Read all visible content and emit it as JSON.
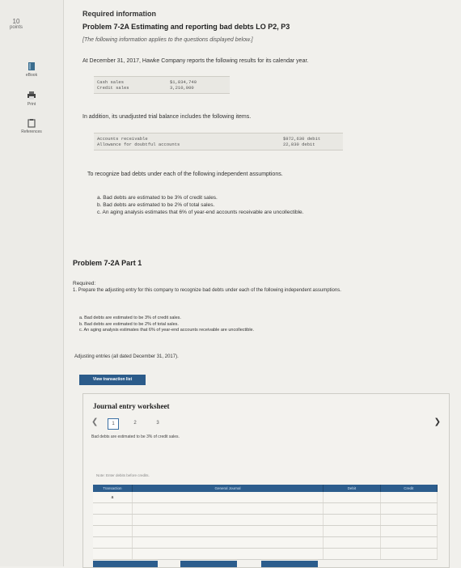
{
  "sidebar": {
    "points_value": "10",
    "points_label": "points",
    "tools": [
      {
        "label": "eBook",
        "icon": "book-icon"
      },
      {
        "label": "Print",
        "icon": "print-icon"
      },
      {
        "label": "References",
        "icon": "references-icon"
      }
    ]
  },
  "header": {
    "required_info": "Required information",
    "problem_title": "Problem 7-2A Estimating and reporting bad debts LO P2, P3",
    "info_note": "[The following information applies to the questions displayed below.]",
    "intro": "At December 31, 2017, Hawke Company reports the following results for its calendar year."
  },
  "sales_table": [
    {
      "label": "Cash sales",
      "value": "$1,834,740"
    },
    {
      "label": "Credit sales",
      "value": "3,210,000"
    }
  ],
  "balance_intro": "In addition, its unadjusted trial balance includes the following items.",
  "balance_table": [
    {
      "label": "Accounts receivable",
      "value": "$972,630 debit"
    },
    {
      "label": "Allowance for doubtful accounts",
      "value": "22,830 debit"
    }
  ],
  "recognize_intro": "To recognize bad debts under each of the following independent assumptions.",
  "assumptions": [
    "a. Bad debts are estimated to be 3% of credit sales.",
    "b. Bad debts are estimated to be 2% of total sales.",
    "c. An aging analysis estimates that 6% of year-end accounts receivable are uncollectible."
  ],
  "part": {
    "title": "Problem 7-2A Part 1",
    "required_label": "Required:",
    "required_text": "1. Prepare the adjusting entry for this company to recognize bad debts under each of the following independent assumptions.",
    "adjusting_label": "Adjusting entries (all dated December 31, 2017)."
  },
  "view_button": "View transaction list",
  "worksheet": {
    "title": "Journal entry worksheet",
    "pages": [
      "1",
      "2",
      "3"
    ],
    "description": "Bad debts are estimated to be 3% of credit sales.",
    "note": "Note: Enter debits before credits.",
    "columns": [
      "Transaction",
      "General Journal",
      "Debit",
      "Credit"
    ],
    "rows": [
      {
        "transaction": "a",
        "general_journal": "",
        "debit": "",
        "credit": ""
      },
      {
        "transaction": "",
        "general_journal": "",
        "debit": "",
        "credit": ""
      },
      {
        "transaction": "",
        "general_journal": "",
        "debit": "",
        "credit": ""
      },
      {
        "transaction": "",
        "general_journal": "",
        "debit": "",
        "credit": ""
      },
      {
        "transaction": "",
        "general_journal": "",
        "debit": "",
        "credit": ""
      },
      {
        "transaction": "",
        "general_journal": "",
        "debit": "",
        "credit": ""
      }
    ]
  },
  "colors": {
    "accent": "#2c5d8d",
    "background": "#f1f0ec"
  }
}
